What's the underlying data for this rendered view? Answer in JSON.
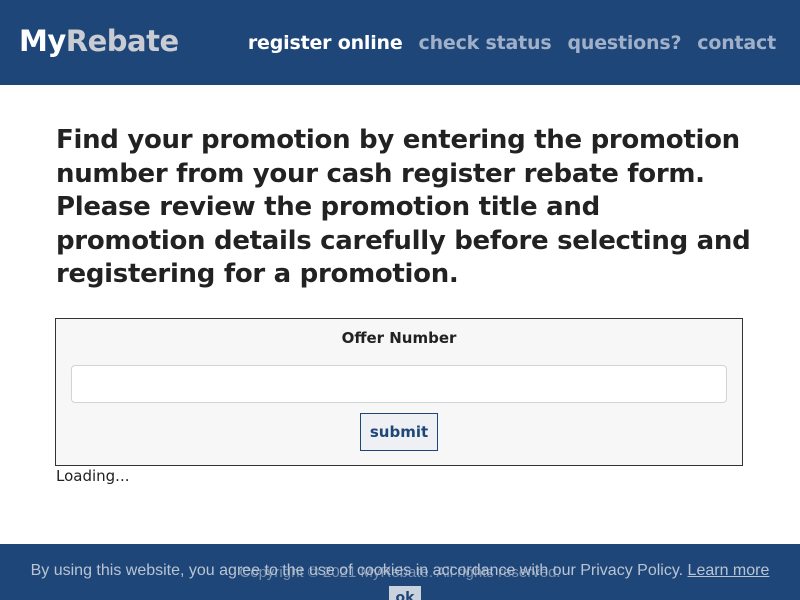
{
  "header": {
    "logo_my": "My",
    "logo_rebate": "Rebate",
    "nav": {
      "register_online": "register online",
      "check_status": "check status",
      "questions": "questions?",
      "contact": "contact"
    }
  },
  "main": {
    "intro": "Find your promotion by entering the promotion number from your cash register rebate form. Please review the promotion title and promotion details carefully before selecting and registering for a promotion.",
    "offer": {
      "label": "Offer Number",
      "value": "",
      "submit_label": "submit"
    },
    "loading_text": "Loading..."
  },
  "footer": {
    "copyright": "Copyright © 2021 MyRebate. All rights reserved.",
    "cookie_text": "By using this website, you agree to the use of cookies in accordance with our Privacy Policy.",
    "learn_more": "Learn more",
    "ok_label": "ok"
  },
  "colors": {
    "brand_navy": "#1f4679",
    "nav_inactive": "#9fb0c8",
    "logo_rebate": "#c9ccd2"
  }
}
